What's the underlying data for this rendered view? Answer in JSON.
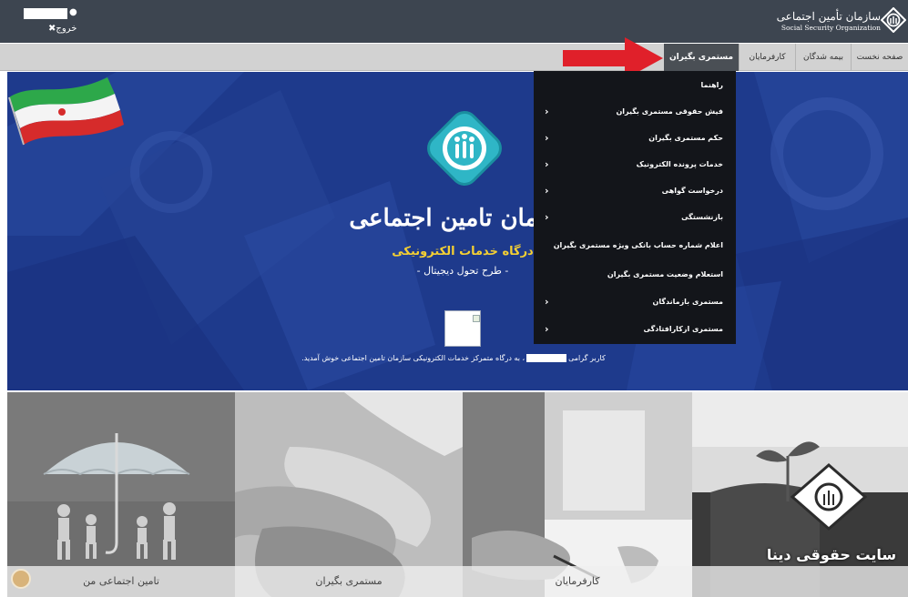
{
  "header": {
    "logout_label": "خروج",
    "logo_fa": "سازمان تأمین اجتماعی",
    "logo_en": "Social Security Organization"
  },
  "nav": {
    "items": [
      {
        "label": "صفحه نخست"
      },
      {
        "label": "بیمه شدگان"
      },
      {
        "label": "کارفرمایان"
      },
      {
        "label": "مستمری بگیران",
        "active": true
      }
    ]
  },
  "hero": {
    "title": "سازمان تامین اجتماعی",
    "subtitle": "درگاه خدمات الکترونیکی",
    "tagline": "- طرح تحول دیجیتال -",
    "welcome_before": "کاربر گرامی",
    "welcome_after": "، به درگاه متمرکز خدمات الکترونیکی سازمان تامین اجتماعی خوش آمدید."
  },
  "dropdown": {
    "items": [
      {
        "label": "راهنما",
        "has_submenu": false
      },
      {
        "label": "فیش حقوقی مستمری بگیران",
        "has_submenu": true
      },
      {
        "label": "حکم مستمری بگیران",
        "has_submenu": true
      },
      {
        "label": "خدمات پرونده الکترونیک",
        "has_submenu": true
      },
      {
        "label": "درخواست گواهی",
        "has_submenu": true
      },
      {
        "label": "بازنشستگی",
        "has_submenu": true
      },
      {
        "label": "اعلام شماره حساب بانکی ویژه مستمری بگیران",
        "has_submenu": false
      },
      {
        "label": "استعلام وضعیت مستمری بگیران",
        "has_submenu": false
      },
      {
        "label": "مستمری بازماندگان",
        "has_submenu": true
      },
      {
        "label": "مستمری ازکارافتادگی",
        "has_submenu": true
      }
    ]
  },
  "tiles": [
    {
      "label": "تامین اجتماعی من"
    },
    {
      "label": "مستمری بگیران"
    },
    {
      "label": "کارفرمایان"
    },
    {
      "label": ""
    }
  ],
  "watermark": "سایت حقوقی دینا",
  "colors": {
    "header_bg": "#3d4550",
    "nav_bg": "#d2d2d2",
    "hero_bg": "#1e3a8c",
    "dropdown_bg": "#13151a",
    "arrow": "#e0202a",
    "subtitle": "#f5d033"
  }
}
